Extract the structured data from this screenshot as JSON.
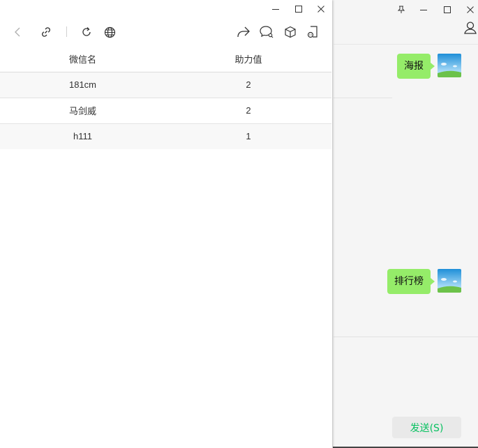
{
  "chat": {
    "messages": [
      {
        "text": "海报"
      },
      {
        "text": "排行榜"
      }
    ],
    "send_label": "发送(S)"
  },
  "web": {
    "table": {
      "headers": [
        "微信名",
        "助力值"
      ],
      "rows": [
        {
          "name": "181cm",
          "value": "2"
        },
        {
          "name": "马剑威",
          "value": "2"
        },
        {
          "name": "h111",
          "value": "1"
        }
      ]
    }
  },
  "colors": {
    "bubble": "#95ec69",
    "send_text": "#07c160",
    "chat_bg": "#f5f5f5"
  },
  "icons": {
    "toolbar": [
      "back-icon",
      "link-icon",
      "refresh-icon",
      "globe-icon",
      "share-icon",
      "chat-search-icon",
      "cube-icon",
      "mini-program-icon"
    ],
    "window_controls": [
      "minimize-icon",
      "maximize-icon",
      "close-icon"
    ],
    "chat_controls": [
      "pin-icon",
      "minimize-icon",
      "maximize-icon",
      "close-icon",
      "user-icon"
    ]
  }
}
